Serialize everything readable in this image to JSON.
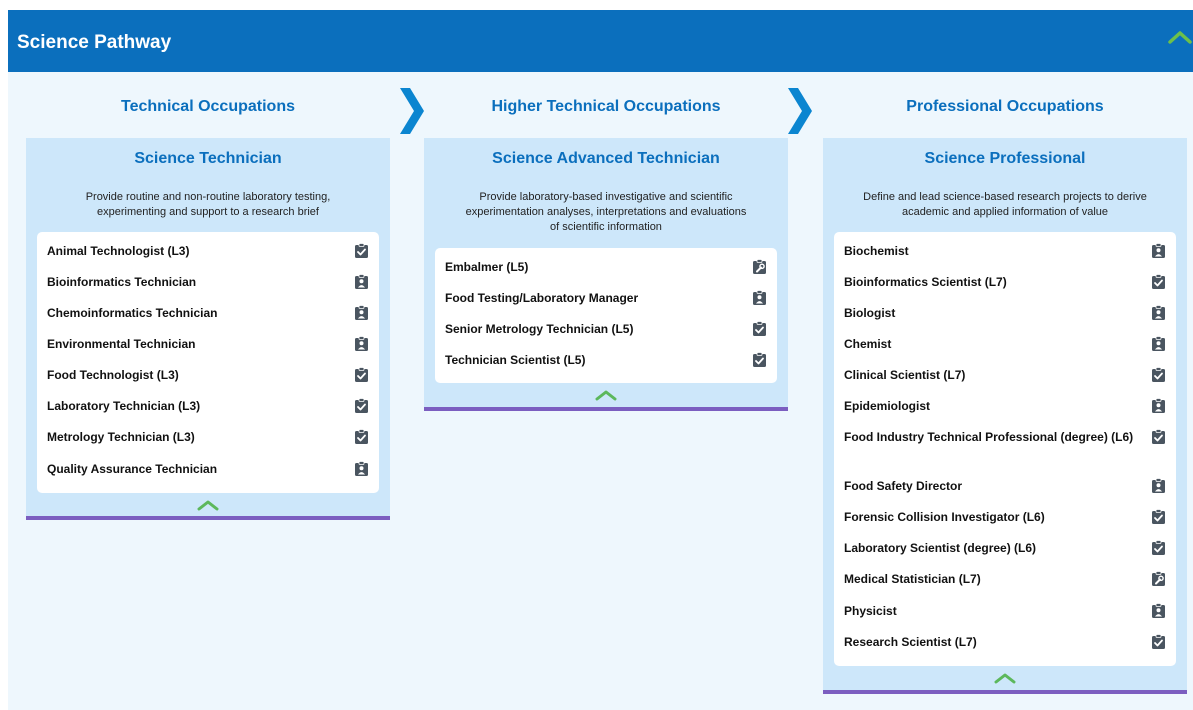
{
  "header": {
    "title": "Science Pathway",
    "toggle_icon": "chevron-up-icon"
  },
  "columns": [
    {
      "heading": "Technical Occupations",
      "card": {
        "title": "Science Technician",
        "description_lines": [
          "Provide routine and non-routine laboratory testing,",
          "experimenting and support to a research brief"
        ],
        "items": [
          {
            "label": "Animal Technologist (L3)",
            "icon": "clipboard-check-icon"
          },
          {
            "label": "Bioinformatics Technician",
            "icon": "clipboard-person-icon"
          },
          {
            "label": "Chemoinformatics Technician",
            "icon": "clipboard-person-icon"
          },
          {
            "label": "Environmental Technician",
            "icon": "clipboard-person-icon"
          },
          {
            "label": "Food Technologist (L3)",
            "icon": "clipboard-check-icon"
          },
          {
            "label": "Laboratory Technician (L3)",
            "icon": "clipboard-check-icon"
          },
          {
            "label": "Metrology Technician (L3)",
            "icon": "clipboard-check-icon"
          },
          {
            "label": "Quality Assurance Technician",
            "icon": "clipboard-person-icon"
          }
        ]
      }
    },
    {
      "heading": "Higher Technical Occupations",
      "card": {
        "title": "Science Advanced Technician",
        "description_lines": [
          "Provide laboratory-based investigative and scientific",
          "experimentation analyses, interpretations and evaluations",
          "of scientific information"
        ],
        "items": [
          {
            "label": "Embalmer (L5)",
            "icon": "clipboard-wrench-icon"
          },
          {
            "label": "Food Testing/Laboratory Manager",
            "icon": "clipboard-person-icon"
          },
          {
            "label": "Senior Metrology Technician (L5)",
            "icon": "clipboard-check-icon"
          },
          {
            "label": "Technician Scientist (L5)",
            "icon": "clipboard-check-icon"
          }
        ]
      }
    },
    {
      "heading": "Professional Occupations",
      "card": {
        "title": "Science Professional",
        "description_lines": [
          "Define and lead science-based research projects to derive",
          "academic and applied information of value"
        ],
        "items": [
          {
            "label": "Biochemist",
            "icon": "clipboard-person-icon"
          },
          {
            "label": "Bioinformatics Scientist (L7)",
            "icon": "clipboard-check-icon"
          },
          {
            "label": "Biologist",
            "icon": "clipboard-person-icon"
          },
          {
            "label": "Chemist",
            "icon": "clipboard-person-icon"
          },
          {
            "label": "Clinical Scientist (L7)",
            "icon": "clipboard-check-icon"
          },
          {
            "label": "Epidemiologist",
            "icon": "clipboard-person-icon"
          },
          {
            "label": "Food Industry Technical Professional (degree) (L6)",
            "icon": "clipboard-check-icon"
          },
          {
            "label": "Food Safety Director",
            "icon": "clipboard-person-icon"
          },
          {
            "label": "Forensic Collision Investigator (L6)",
            "icon": "clipboard-check-icon"
          },
          {
            "label": "Laboratory Scientist (degree) (L6)",
            "icon": "clipboard-check-icon"
          },
          {
            "label": "Medical Statistician (L7)",
            "icon": "clipboard-wrench-icon"
          },
          {
            "label": "Physicist",
            "icon": "clipboard-person-icon"
          },
          {
            "label": "Research Scientist (L7)",
            "icon": "clipboard-check-icon"
          }
        ]
      }
    }
  ],
  "colors": {
    "header_bg": "#0b6fbd",
    "accent": "#0b6fbd",
    "card_bg": "#cde7fa",
    "card_border": "#7b5ec0",
    "chevron": "#5cb85c",
    "icon": "#4a5560"
  }
}
